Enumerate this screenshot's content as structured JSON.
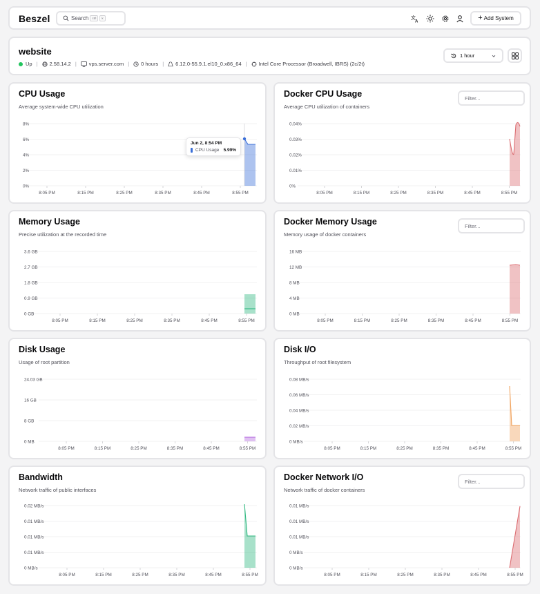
{
  "header": {
    "logo": "Beszel",
    "search_label": "Search",
    "search_kbd": [
      "ctrl",
      "k"
    ],
    "add_button_label": "Add System",
    "icons": [
      "language-icon",
      "theme-sun-icon",
      "settings-gear-icon",
      "user-icon"
    ]
  },
  "system": {
    "name": "website",
    "status": "Up",
    "status_color": "#22c55e",
    "version": "2.58.14.2",
    "host": "vps.server.com",
    "uptime": "0 hours",
    "kernel": "6.12.0-55.9.1.el10_0.x86_64",
    "cpu": "Intel Core Processor (Broadwell, IBRS) (2c/2t)",
    "time_range": "1 hour"
  },
  "x_ticks": [
    "8:05 PM",
    "8:15 PM",
    "8:25 PM",
    "8:35 PM",
    "8:45 PM",
    "8:55 PM"
  ],
  "filter_placeholder": "Filter...",
  "charts": {
    "cpu": {
      "title": "CPU Usage",
      "subtitle": "Average system-wide CPU utilization",
      "y_ticks": [
        "8%",
        "6%",
        "4%",
        "2%",
        "0%"
      ],
      "tooltip": {
        "date": "Jun 2, 8:54 PM",
        "label": "CPU Usage",
        "value": "5.99%"
      },
      "color": "#3b6fd8"
    },
    "docker_cpu": {
      "title": "Docker CPU Usage",
      "subtitle": "Average CPU utilization of containers",
      "y_ticks": [
        "0.04%",
        "0.03%",
        "0.02%",
        "0.01%",
        "0%"
      ],
      "color": "#dc6d72"
    },
    "memory": {
      "title": "Memory Usage",
      "subtitle": "Precise utilization at the recorded time",
      "y_ticks": [
        "3.6 GB",
        "2.7 GB",
        "1.8 GB",
        "0.9 GB",
        "0 GB"
      ],
      "color": "#2fb880"
    },
    "docker_memory": {
      "title": "Docker Memory Usage",
      "subtitle": "Memory usage of docker containers",
      "y_ticks": [
        "16 MB",
        "12 MB",
        "8 MB",
        "4 MB",
        "0 MB"
      ],
      "color": "#dc6d72"
    },
    "disk": {
      "title": "Disk Usage",
      "subtitle": "Usage of root partition",
      "y_ticks": [
        "24.03 GB",
        "16 GB",
        "8 GB",
        "0 MB"
      ],
      "color": "#b46ce0"
    },
    "disk_io": {
      "title": "Disk I/O",
      "subtitle": "Throughput of root filesystem",
      "y_ticks": [
        "0.08 MB/s",
        "0.06 MB/s",
        "0.04 MB/s",
        "0.02 MB/s",
        "0 MB/s"
      ],
      "color": "#f0a35e"
    },
    "bandwidth": {
      "title": "Bandwidth",
      "subtitle": "Network traffic of public interfaces",
      "y_ticks": [
        "0.02 MB/s",
        "0.01 MB/s",
        "0.01 MB/s",
        "0.01 MB/s",
        "0 MB/s"
      ],
      "color": "#2fb880"
    },
    "docker_network": {
      "title": "Docker Network I/O",
      "subtitle": "Network traffic of docker containers",
      "y_ticks": [
        "0.01 MB/s",
        "0.01 MB/s",
        "0.01 MB/s",
        "0 MB/s",
        "0 MB/s"
      ],
      "color": "#dc6d72"
    }
  }
}
